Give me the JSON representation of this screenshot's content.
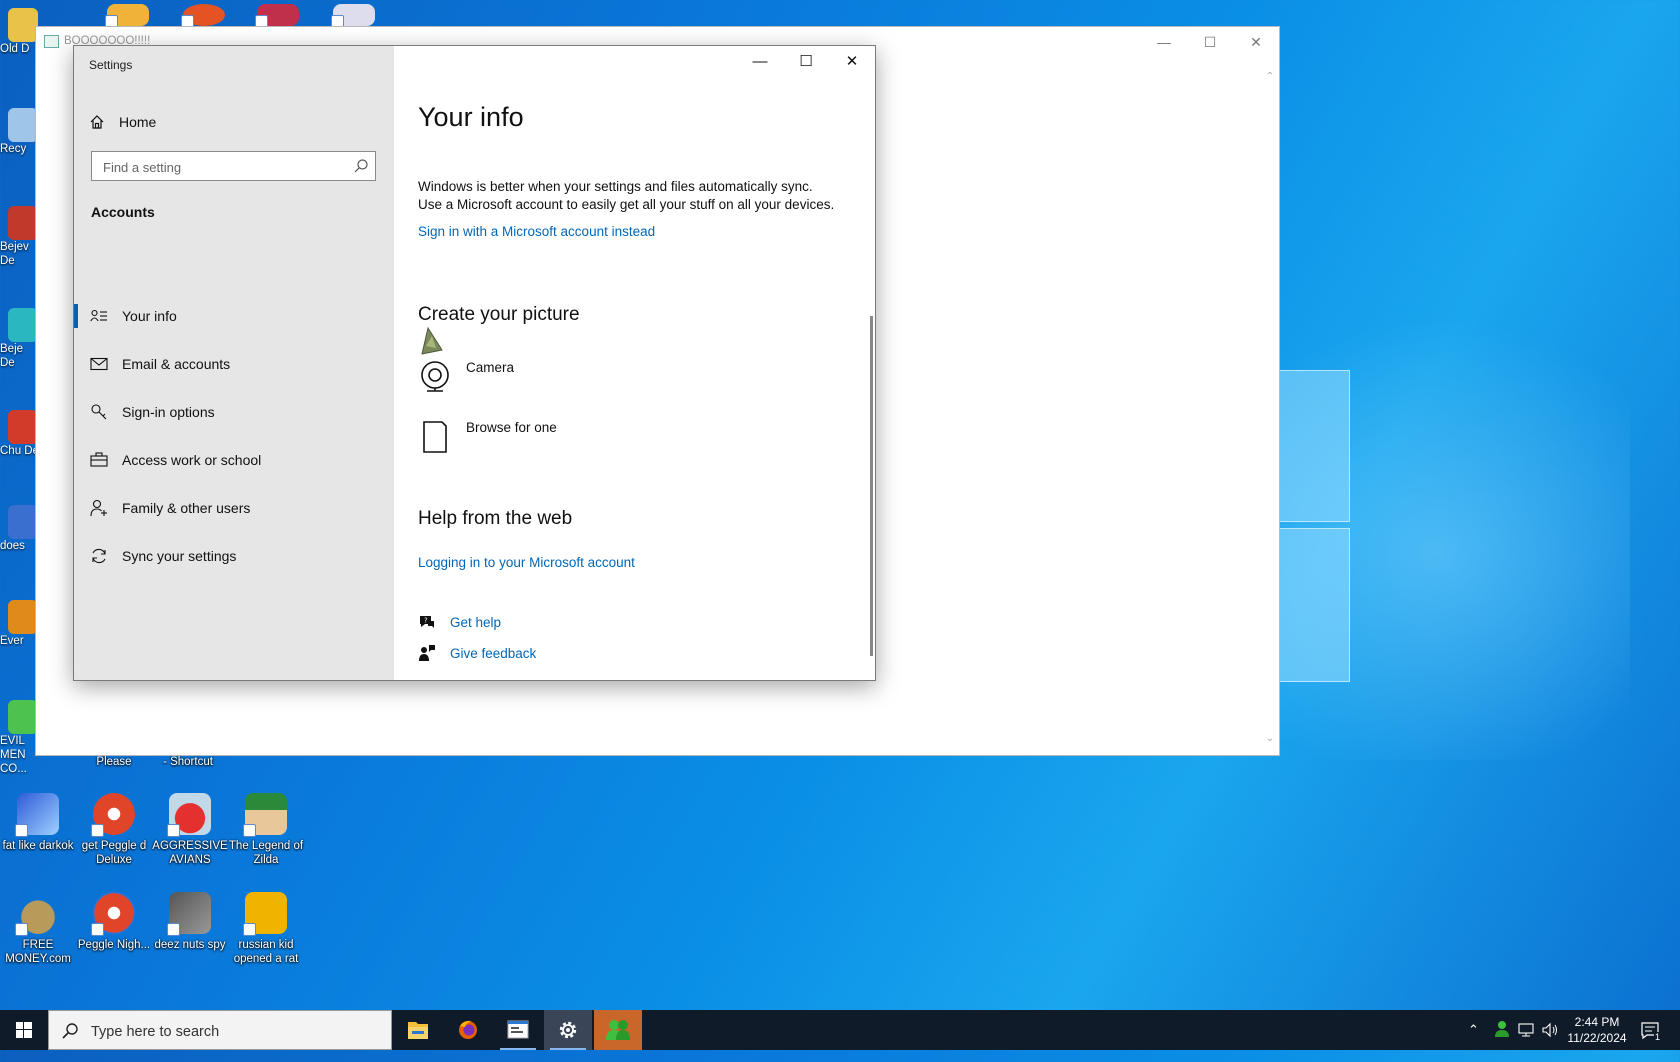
{
  "desktop": {
    "icons": [
      {
        "label": "fat like darkok"
      },
      {
        "label": "get Peggle d Deluxe"
      },
      {
        "label": "AGGRESSIVE AVIANS"
      },
      {
        "label": "The Legend of Zilda"
      },
      {
        "label": "FREE MONEY.com"
      },
      {
        "label": "Peggle Nigh..."
      },
      {
        "label": "deez nuts spy"
      },
      {
        "label": "russian kid opened a rat"
      }
    ],
    "edge_labels": [
      "Old D",
      "Recy",
      "Bejev De",
      "Beje De",
      "Chu De",
      "does",
      "Ever",
      "EVIL MEN CO..."
    ],
    "partial_labels": [
      "Please",
      "- Shortcut"
    ]
  },
  "background_window": {
    "title": "BOOOOOOO!!!!!"
  },
  "settings": {
    "app_title": "Settings",
    "home_label": "Home",
    "search_placeholder": "Find a setting",
    "section_title": "Accounts",
    "nav": [
      {
        "label": "Your info",
        "icon": "person-card-icon",
        "active": true
      },
      {
        "label": "Email & accounts",
        "icon": "mail-icon"
      },
      {
        "label": "Sign-in options",
        "icon": "key-icon"
      },
      {
        "label": "Access work or school",
        "icon": "briefcase-icon"
      },
      {
        "label": "Family & other users",
        "icon": "add-person-icon"
      },
      {
        "label": "Sync your settings",
        "icon": "sync-icon"
      }
    ],
    "page_title": "Your info",
    "sync_text_line1": "Windows is better when your settings and files automatically sync.",
    "sync_text_line2": "Use a Microsoft account to easily get all your stuff on all your devices.",
    "signin_link": "Sign in with a Microsoft account instead",
    "create_picture_title": "Create your picture",
    "camera_label": "Camera",
    "browse_label": "Browse for one",
    "help_title": "Help from the web",
    "help_link": "Logging in to your Microsoft account",
    "get_help": "Get help",
    "give_feedback": "Give feedback"
  },
  "taskbar": {
    "search_placeholder": "Type here to search",
    "time": "2:44 PM",
    "date": "11/22/2024",
    "notifications_count": "1"
  },
  "colors": {
    "accent": "#0063b1",
    "link": "#0067b8",
    "sidebar_bg": "#e6e6e6",
    "taskbar_bg": "#101b2a"
  }
}
